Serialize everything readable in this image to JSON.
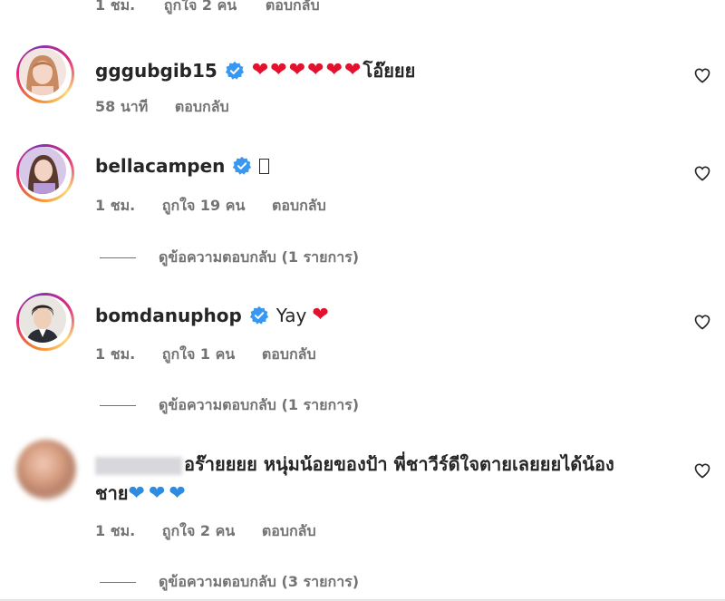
{
  "top_meta": {
    "time": "1 ชม.",
    "likes": "ถูกใจ 2 คน",
    "reply": "ตอบกลับ"
  },
  "comments": [
    {
      "username": "gggubgib15",
      "text": "โอ๊ยยย",
      "hearts": [
        "red",
        "red",
        "red",
        "red",
        "red",
        "red"
      ],
      "time": "58 นาที",
      "likes": "",
      "reply": "ตอบกลับ",
      "view_replies": ""
    },
    {
      "username": "bellacampen",
      "text": "󠀠",
      "time": "1 ชม.",
      "likes": "ถูกใจ 19 คน",
      "reply": "ตอบกลับ",
      "view_replies": "ดูข้อความตอบกลับ (1 รายการ)"
    },
    {
      "username": "bomdanuphop",
      "text": "Yay",
      "hearts": [
        "red"
      ],
      "time": "1 ชม.",
      "likes": "ถูกใจ 1 คน",
      "reply": "ตอบกลับ",
      "view_replies": "ดูข้อความตอบกลับ (1 รายการ)"
    },
    {
      "username": "",
      "text_line1": "อร๊ายยยย หนุ่มน้อยของป้า พี่ชาวีร์ดีใจตายเลยยยได้น้อง",
      "text_line2": "ชาย",
      "hearts": [
        "blue",
        "blue",
        "blue"
      ],
      "time": "1 ชม.",
      "likes": "ถูกใจ 2 คน",
      "reply": "ตอบกลับ",
      "view_replies": "ดูข้อความตอบกลับ (3 รายการ)"
    }
  ],
  "colors": {
    "verified": "#3897f0",
    "heart_red": "#e3112d",
    "heart_blue": "#2d8be0",
    "meta": "#737373"
  },
  "icons": {
    "like": "heart-outline-icon",
    "verified": "verified-badge-icon"
  }
}
